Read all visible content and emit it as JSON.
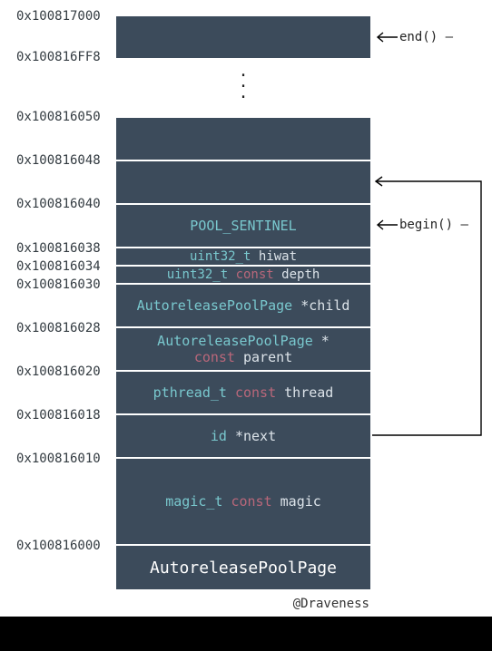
{
  "addresses": {
    "a_end_top": "0x100817000",
    "a_end_bot": "0x100816FF8",
    "a_050": "0x100816050",
    "a_048": "0x100816048",
    "a_040": "0x100816040",
    "a_038": "0x100816038",
    "a_034": "0x100816034",
    "a_030": "0x100816030",
    "a_028": "0x100816028",
    "a_020": "0x100816020",
    "a_018": "0x100816018",
    "a_010": "0x100816010",
    "a_000": "0x100816000"
  },
  "cells": {
    "sentinel": "POOL_SENTINEL",
    "hiwat": {
      "type": "uint32_t",
      "name": "hiwat"
    },
    "depth": {
      "type": "uint32_t",
      "kw": "const",
      "name": "depth"
    },
    "child": {
      "type": "AutoreleasePoolPage",
      "ptr": "*",
      "name": "child"
    },
    "parent": {
      "type": "AutoreleasePoolPage",
      "ptr": "*",
      "kw": "const",
      "name": "parent"
    },
    "thread": {
      "type": "pthread_t",
      "kw": "const",
      "name": "thread"
    },
    "next": {
      "type": "id",
      "ptr": "*",
      "name": "next"
    },
    "magic": {
      "type": "magic_t",
      "kw": "const",
      "name": "magic"
    }
  },
  "caption": "AutoreleasePoolPage",
  "annot": {
    "end": "end()",
    "begin": "begin()"
  },
  "credit": "@Draveness"
}
